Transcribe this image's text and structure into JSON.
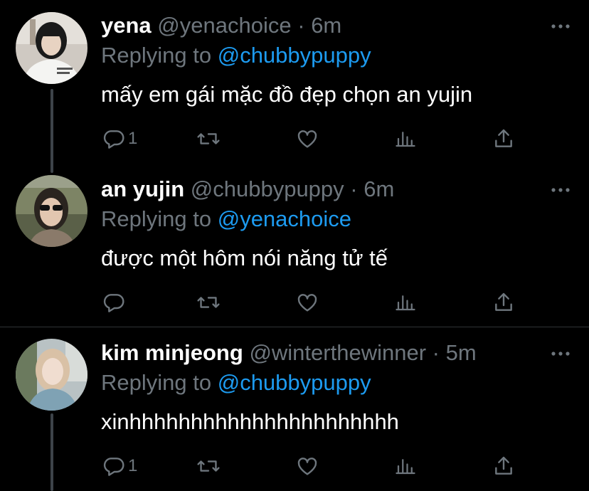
{
  "tweets": [
    {
      "name": "yena",
      "handle": "@yenachoice",
      "dot": "·",
      "time": "6m",
      "replying_prefix": "Replying to ",
      "replying_to": "@chubbypuppy",
      "text": "mấy em gái mặc đồ đẹp chọn an yujin",
      "reply_count": "1"
    },
    {
      "name": "an yujin",
      "handle": "@chubbypuppy",
      "dot": "·",
      "time": "6m",
      "replying_prefix": "Replying to ",
      "replying_to": "@yenachoice",
      "text": "được một hôm nói năng tử tế",
      "reply_count": ""
    },
    {
      "name": "kim minjeong",
      "handle": "@winterthewinner",
      "dot": "·",
      "time": "5m",
      "replying_prefix": "Replying to ",
      "replying_to": "@chubbypuppy",
      "text": "xinhhhhhhhhhhhhhhhhhhhhhh",
      "reply_count": "1"
    }
  ],
  "colors": {
    "background": "#000000",
    "secondary_text": "#6e767d",
    "link": "#1d9bf0",
    "thread_line": "#3d4349",
    "divider": "#2f3336"
  },
  "icons": [
    "reply-icon",
    "retweet-icon",
    "like-icon",
    "analytics-icon",
    "share-icon",
    "more-icon"
  ]
}
